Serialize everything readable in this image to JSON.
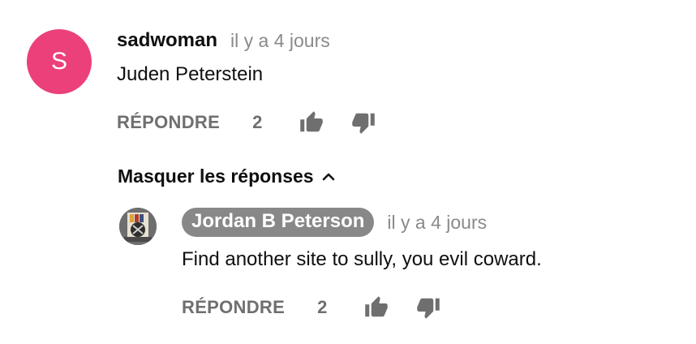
{
  "comment": {
    "avatar_letter": "S",
    "avatar_color": "#ec407a",
    "author": "sadwoman",
    "time": "il y a 4 jours",
    "text": "Juden Peterstein",
    "reply_label": "RÉPONDRE",
    "like_count": "2",
    "like_icon": "thumb-up-icon",
    "dislike_icon": "thumb-down-icon"
  },
  "replies_toggle": {
    "label": "Masquer les réponses",
    "icon": "chevron-up-icon"
  },
  "reply": {
    "avatar_icon": "profile-picture",
    "author": "Jordan B Peterson",
    "author_chip_color": "#888888",
    "time": "il y a 4 jours",
    "text": "Find another site to sully, you evil coward.",
    "reply_label": "RÉPONDRE",
    "like_count": "2",
    "like_icon": "thumb-up-icon",
    "dislike_icon": "thumb-down-icon"
  }
}
